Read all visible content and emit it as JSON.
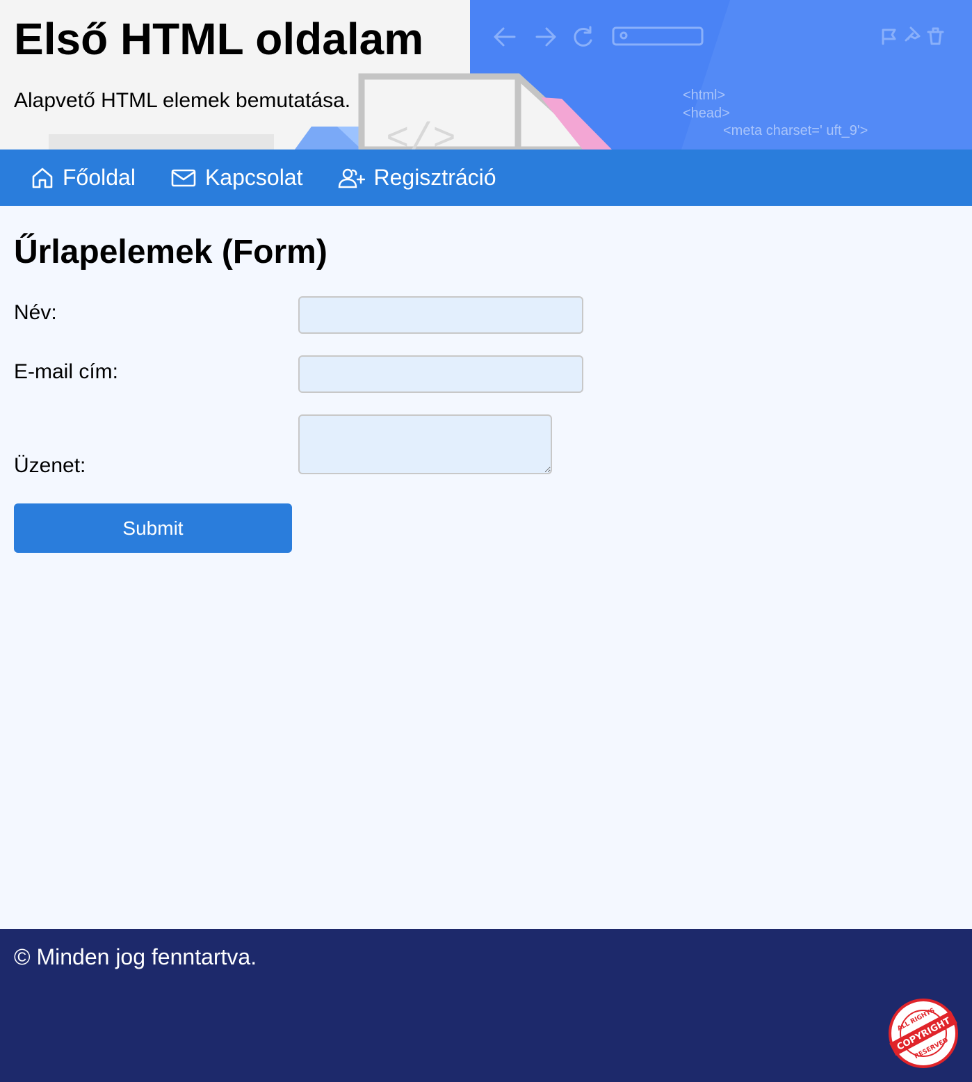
{
  "header": {
    "title": "Első HTML oldalam",
    "subtitle": "Alapvető HTML elemek bemutatása.",
    "art_code": [
      "<html>",
      "<head>",
      "<meta charset=' uft_9'>"
    ]
  },
  "nav": {
    "items": [
      {
        "label": "Főoldal",
        "icon": "home-icon"
      },
      {
        "label": "Kapcsolat",
        "icon": "mail-icon"
      },
      {
        "label": "Regisztráció",
        "icon": "user-plus-icon"
      }
    ]
  },
  "form": {
    "heading": "Űrlapelemek (Form)",
    "name_label": "Név:",
    "name_value": "",
    "email_label": "E-mail cím:",
    "email_value": "",
    "message_label": "Üzenet:",
    "message_value": "",
    "submit_label": "Submit"
  },
  "footer": {
    "text": "© Minden jog fenntartva."
  },
  "stamp": {
    "top_text": "ALL RIGHTS",
    "middle_text": "COPYRIGHT",
    "bottom_text": "RESERVED"
  },
  "colors": {
    "nav_bg": "#2a7ddc",
    "page_bg": "#f4f8ff",
    "footer_bg": "#1d296b",
    "input_bg": "#e3effd",
    "hero_blue": "#4a83f5"
  }
}
